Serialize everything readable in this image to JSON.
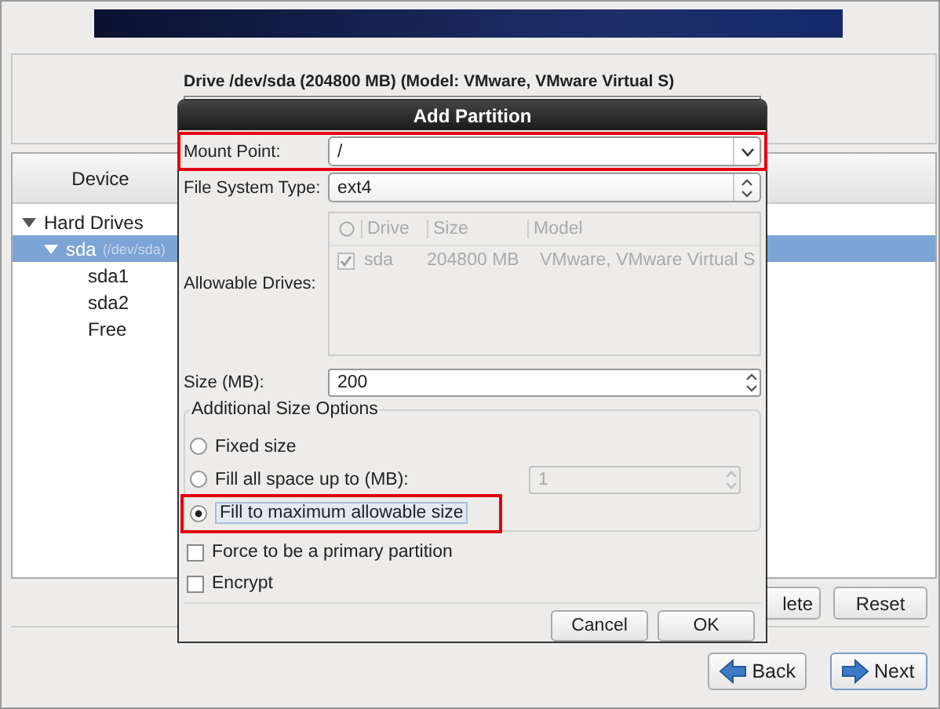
{
  "window": {
    "drive_label": "Drive /dev/sda (204800 MB) (Model: VMware, VMware Virtual S)",
    "device_column": "Device",
    "tree": [
      {
        "label": "Hard Drives",
        "expanded": true,
        "selected": false,
        "children": [
          {
            "label": "sda",
            "detail": "(/dev/sda)",
            "expanded": true,
            "selected": true,
            "children": [
              {
                "label": "sda1",
                "selected": false
              },
              {
                "label": "sda2",
                "selected": false
              },
              {
                "label": "Free",
                "selected": false
              }
            ]
          }
        ]
      }
    ],
    "buttons": [
      "lete",
      "Reset"
    ],
    "nav_buttons": [
      {
        "label": "Back",
        "kind": "back"
      },
      {
        "label": "Next",
        "kind": "next"
      }
    ]
  },
  "dialog": {
    "title": "Add Partition",
    "mount_point": {
      "label": "Mount Point:",
      "value": "/",
      "highlighted": true
    },
    "fs_type": {
      "label": "File System Type:",
      "value": "ext4"
    },
    "drives": {
      "label": "Allowable Drives:",
      "disabled": true,
      "columns": [
        "Drive",
        "Size",
        "Model"
      ],
      "rows": [
        {
          "checked": true,
          "drive": "sda",
          "size": "204800 MB",
          "model": "VMware, VMware Virtual S"
        }
      ]
    },
    "size": {
      "label": "Size (MB):",
      "value": "200"
    },
    "size_options": {
      "title": "Additional Size Options",
      "options": [
        {
          "label": "Fixed size",
          "selected": false,
          "highlighted": false
        },
        {
          "label": "Fill all space up to (MB):",
          "selected": false,
          "highlighted": false,
          "field": {
            "value": "1",
            "disabled": true
          }
        },
        {
          "label": "Fill to maximum allowable size",
          "selected": true,
          "highlighted": true
        }
      ]
    },
    "checkboxes": [
      {
        "label": "Force to be a primary partition",
        "checked": false
      },
      {
        "label": "Encrypt",
        "checked": false
      }
    ],
    "buttons": [
      "Cancel",
      "OK"
    ]
  }
}
